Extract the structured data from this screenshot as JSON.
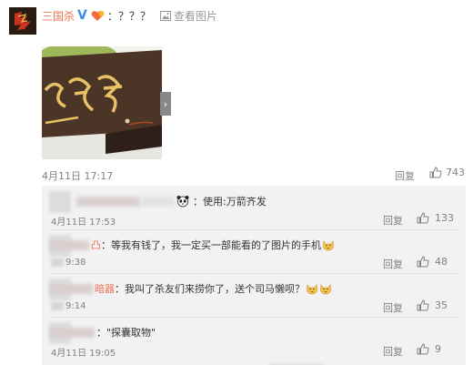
{
  "post": {
    "username": "三国杀",
    "verified_badge": "V",
    "text": "：？？？",
    "view_image_label": "查看图片",
    "time": "4月11日 17:17",
    "reply_label": "回复",
    "likes": "743",
    "next_arrow": "›"
  },
  "comments": [
    {
      "name_suffix": "",
      "text": "：使用:万箭齐发",
      "time": "4月11日 17:53",
      "reply_label": "回复",
      "likes": "133"
    },
    {
      "name_suffix": "凸",
      "text": "：等我有钱了，我一定买一部能看的了图片的手机",
      "time": "9:38",
      "reply_label": "回复",
      "likes": "48"
    },
    {
      "name_suffix": "暗器",
      "text": "：我叫了杀友们来捞你了，送个司马懒呗？",
      "time": "9:14",
      "reply_label": "回复",
      "likes": "35"
    },
    {
      "name_suffix": "",
      "text": "：\"探囊取物\"",
      "time": "4月11日 19:05",
      "reply_label": "回复",
      "likes": "9"
    }
  ],
  "icons": {
    "avatar": "sanguosha-logo",
    "medal": "heart-medal-icon",
    "view_image": "image-icon",
    "like": "thumbs-up-icon",
    "emoji": "smiling-cat-emoji-icon",
    "panda": "panda-emoji-icon"
  },
  "colors": {
    "username": "#eb7350",
    "verified": "#3b8ee8",
    "meta": "#808080",
    "comment_bg": "#f2f2f5"
  }
}
